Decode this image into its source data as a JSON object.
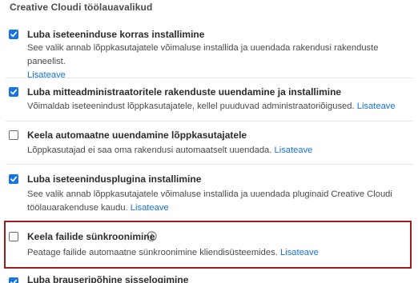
{
  "section": {
    "title": "Creative Cloudi töölauavalikud"
  },
  "options": [
    {
      "title": "Luba iseteeninduse korras installimine",
      "checked": true,
      "desc": "See valik annab lõppkasutajatele võimaluse installida ja uuendada rakendusi rakenduste paneelist.",
      "link": "Lisateave"
    },
    {
      "title": "Luba mitteadministraatoritele rakenduste uuendamine ja installimine",
      "checked": true,
      "desc": "Võimaldab iseteenindust lõppkasutajatele, kellel puuduvad administraatoriõigused.",
      "link": "Lisateave"
    },
    {
      "title": "Keela automaatne uuendamine lõppkasutajatele",
      "checked": false,
      "desc": "Lõppkasutajad ei saa oma rakendusi automaatselt uuendada.",
      "link": "Lisateave"
    },
    {
      "title": "Luba iseteenindusplugina installimine",
      "checked": true,
      "desc": "See valik annab lõppkasutajatele võimaluse installida ja uuendada pluginaid Creative Cloudi töölauarakenduse kaudu.",
      "link": "Lisateave"
    },
    {
      "title": "Keela failide sünkroonimine",
      "checked": false,
      "desc": "Peatage failide automaatne sünkroonimine kliendisüsteemides.",
      "link": "Lisateave"
    },
    {
      "title": "Luba brauseripõhine sisselogimine",
      "checked": true
    }
  ],
  "colors": {
    "accent": "#1473e6",
    "highlight_border": "#9c1d1d",
    "divider": "#e6e6e6"
  },
  "icons": {
    "checked": "checkmark-icon",
    "info": "info-circle-icon"
  }
}
